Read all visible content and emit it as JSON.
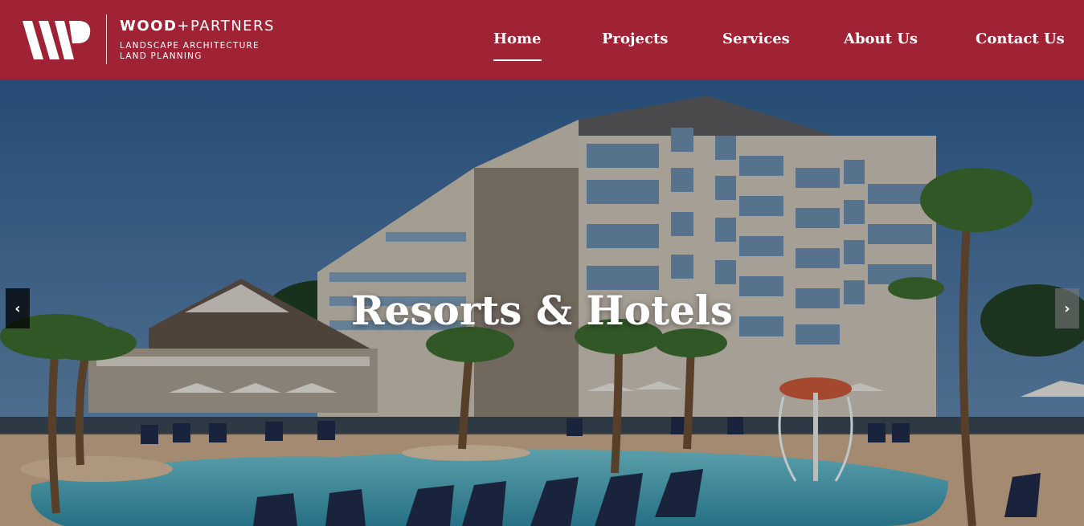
{
  "brand": {
    "name_bold": "WOOD",
    "name_plus": "+",
    "name_light": "PARTNERS",
    "tagline_line1": "LANDSCAPE ARCHITECTURE",
    "tagline_line2": "LAND PLANNING"
  },
  "nav": {
    "items": [
      {
        "label": "Home",
        "active": true
      },
      {
        "label": "Projects",
        "active": false
      },
      {
        "label": "Services",
        "active": false
      },
      {
        "label": "About Us",
        "active": false
      },
      {
        "label": "Contact Us",
        "active": false
      }
    ]
  },
  "hero": {
    "title": "Resorts & Hotels",
    "prev_icon": "chevron-left-icon",
    "next_icon": "chevron-right-icon",
    "prev_glyph": "‹",
    "next_glyph": "›"
  },
  "colors": {
    "header_bg": "#a02235",
    "sky": "#3f6c9a",
    "pool": "#4fa9bd"
  }
}
